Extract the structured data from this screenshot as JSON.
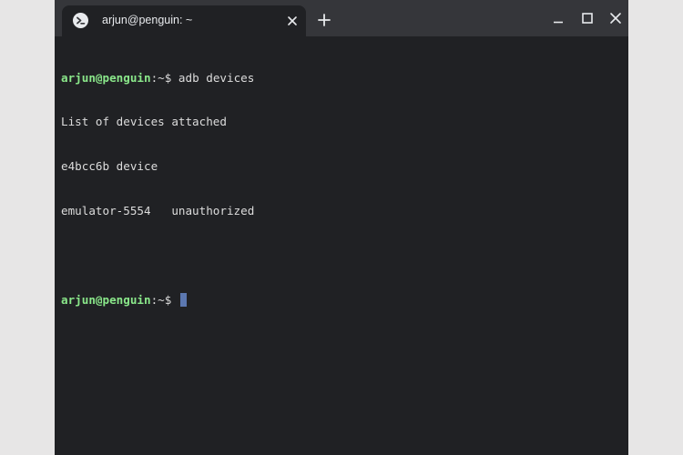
{
  "tab": {
    "title": "arjun@penguin: ~",
    "icon": "terminal-icon"
  },
  "window_controls": {
    "minimize_icon": "minimize-icon",
    "maximize_icon": "maximize-icon",
    "close_icon": "close-icon",
    "new_tab_icon": "plus-icon"
  },
  "terminal": {
    "prompt_user": "arjun@penguin",
    "prompt_suffix": ":~$",
    "command": " adb devices",
    "output": [
      "List of devices attached",
      "e4bcc6b device",
      "emulator-5554   unauthorized"
    ]
  },
  "colors": {
    "background": "#202124",
    "titlebar": "#35363a",
    "prompt_user": "#8ae78a",
    "cursor": "#5c78b0"
  }
}
